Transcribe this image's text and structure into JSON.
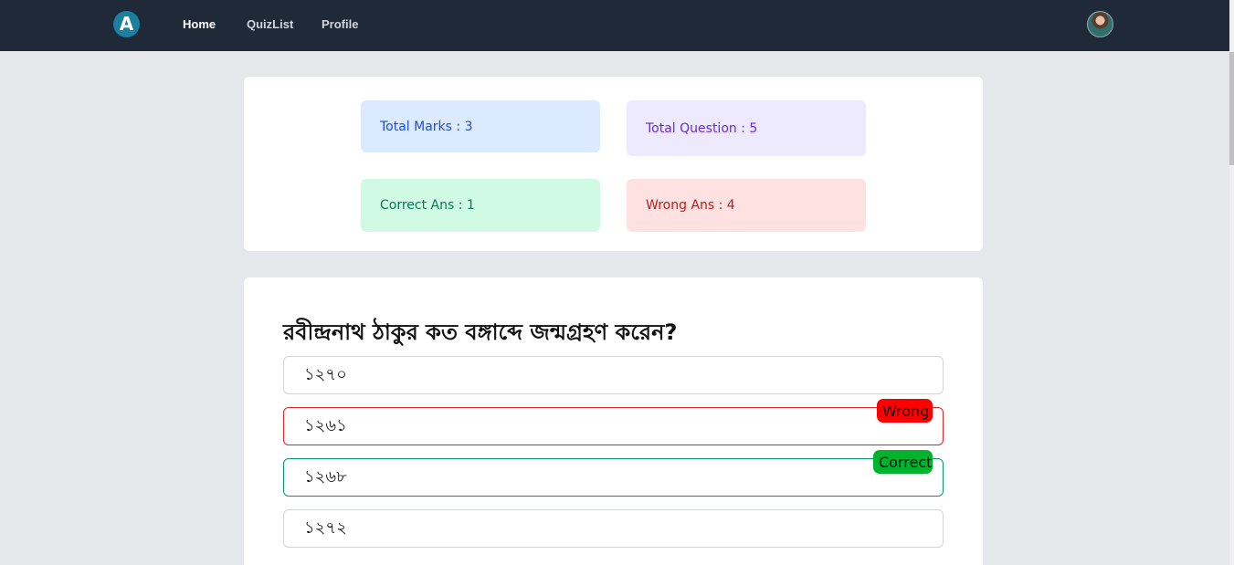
{
  "nav": {
    "logo_letter": "A",
    "links": [
      {
        "label": "Home"
      },
      {
        "label": "QuizList"
      },
      {
        "label": "Profile"
      }
    ]
  },
  "summary": {
    "total_marks": "Total Marks : 3",
    "total_question": "Total Question : 5",
    "correct_ans": "Correct Ans : 1",
    "wrong_ans": "Wrong Ans : 4"
  },
  "question": {
    "text": "রবীন্দ্রনাথ ঠাকুর কত বঙ্গাব্দে জন্মগ্রহণ করেন?",
    "options": [
      {
        "label": "১২৭০"
      },
      {
        "label": "১২৬১"
      },
      {
        "label": "১২৬৮"
      },
      {
        "label": "১২৭২"
      }
    ],
    "wrong_badge": "Wrong",
    "correct_badge": "Correct"
  },
  "colors": {
    "navbar": "#1f2937",
    "wrong": "#ff0000",
    "correct": "#00b32c"
  }
}
